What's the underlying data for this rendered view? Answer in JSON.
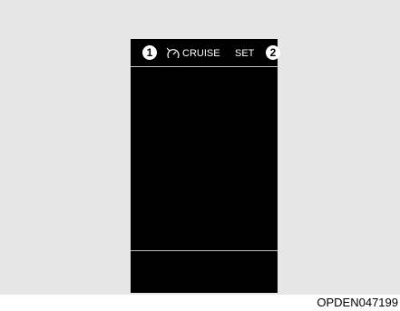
{
  "display": {
    "markers": [
      "1",
      "2"
    ],
    "cruise_icon": "cruise-control-icon",
    "cruise_label": "CRUISE",
    "set_label": "SET"
  },
  "figure_code": "OPDEN047199",
  "colors": {
    "background": "#e6e6e6",
    "screen": "#000000",
    "text": "#ffffff",
    "divider": "#bdbdbd"
  }
}
